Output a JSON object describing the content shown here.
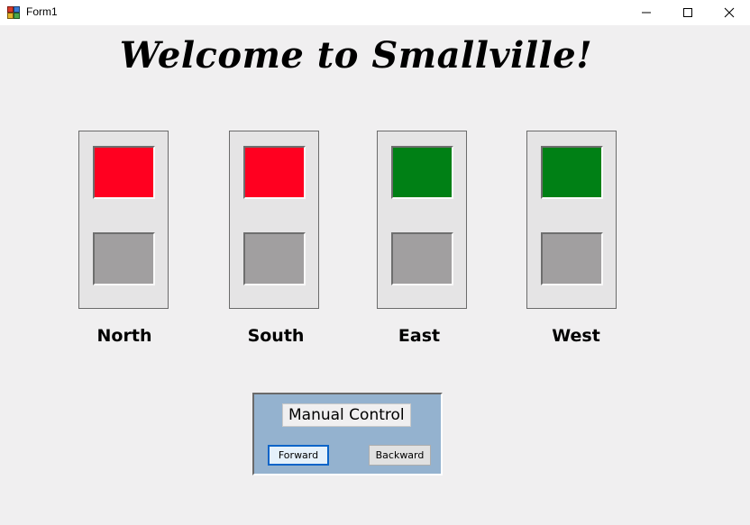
{
  "window": {
    "title": "Form1",
    "controls": {
      "minimize_icon": "minimize-icon",
      "maximize_icon": "maximize-icon",
      "close_icon": "close-icon"
    }
  },
  "heading": "Welcome to Smallville!",
  "lights": [
    {
      "label": "North",
      "top_color": "#ff0020",
      "bottom_color": "#a19fa0"
    },
    {
      "label": "South",
      "top_color": "#ff0020",
      "bottom_color": "#a19fa0"
    },
    {
      "label": "East",
      "top_color": "#008015",
      "bottom_color": "#a19fa0"
    },
    {
      "label": "West",
      "top_color": "#008015",
      "bottom_color": "#a19fa0"
    }
  ],
  "manual_control": {
    "label": "Manual Control",
    "forward_label": "Forward",
    "backward_label": "Backward"
  }
}
